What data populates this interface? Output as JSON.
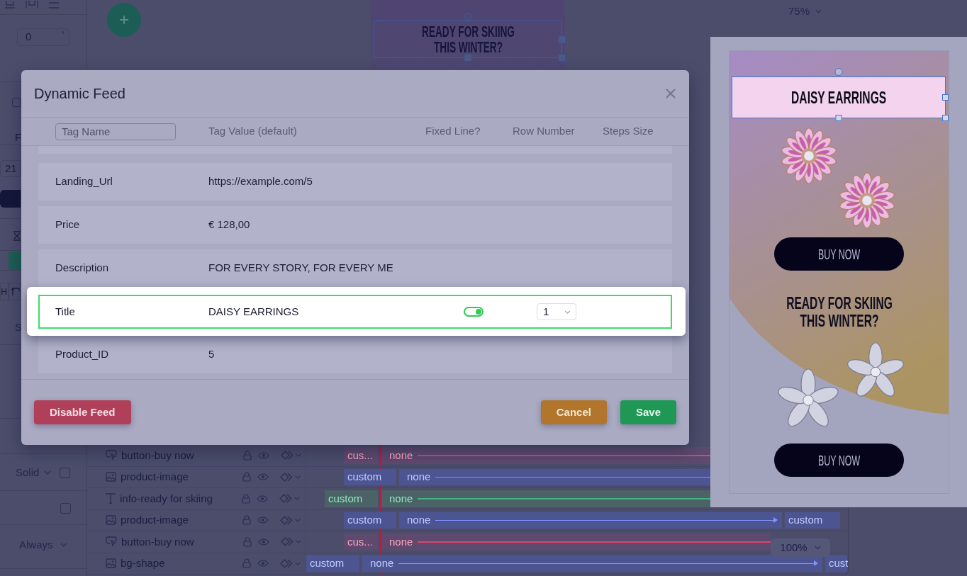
{
  "properties_panel": {
    "rotation": {
      "value": "0",
      "unit": "°"
    },
    "checkbox_1": {
      "checked": false
    },
    "label_1": "F",
    "field_1": "21",
    "label_2": "H",
    "label_3": "S",
    "border_style": "Solid",
    "checkbox_2": {
      "checked": false
    },
    "checkbox_3": {
      "checked": false
    },
    "visibility": "Always"
  },
  "canvas": {
    "headline": "READY FOR SKIING THIS WINTER?",
    "zoom": "75%"
  },
  "timeline": {
    "layers": [
      {
        "kind": "button",
        "name": "button-buy now",
        "segments": [
          {
            "label": "cus..."
          },
          {
            "label": "none"
          }
        ]
      },
      {
        "kind": "image",
        "name": "product-image",
        "segments": [
          {
            "label": "custom"
          },
          {
            "label": "none"
          }
        ]
      },
      {
        "kind": "text",
        "name": "info-ready for skiing",
        "segments": [
          {
            "label": "custom"
          },
          {
            "label": "none"
          }
        ]
      },
      {
        "kind": "image",
        "name": "product-image",
        "segments": [
          {
            "label": "custom"
          },
          {
            "label": "none"
          },
          {
            "label": "custom"
          }
        ]
      },
      {
        "kind": "button",
        "name": "button-buy now",
        "segments": [
          {
            "label": "cus..."
          },
          {
            "label": "none"
          }
        ]
      },
      {
        "kind": "image",
        "name": "bg-shape",
        "segments": [
          {
            "label": "custom"
          },
          {
            "label": "none"
          },
          {
            "label": "cust"
          }
        ]
      }
    ],
    "zoom": "100%"
  },
  "dialog": {
    "title": "Dynamic Feed",
    "filter": {
      "placeholder": "Tag Name"
    },
    "columns": [
      "Tag Value (default)",
      "Fixed Line?",
      "Row Number",
      "Steps Size"
    ],
    "rows": [
      {
        "tag": "Landing_Url",
        "value": "https://example.com/5",
        "highlighted": false
      },
      {
        "tag": "Price",
        "value": "€ 128,00",
        "highlighted": false
      },
      {
        "tag": "Description",
        "value": "FOR EVERY STORY, FOR EVERY ME",
        "highlighted": false
      },
      {
        "tag": "Title",
        "value": "DAISY EARRINGS",
        "highlighted": true,
        "fixed_line": {
          "on": true
        },
        "row_number": "1"
      },
      {
        "tag": "Product_ID",
        "value": "5",
        "highlighted": false
      }
    ],
    "buttons": [
      {
        "kind": "danger",
        "label": "Disable Feed"
      },
      {
        "kind": "warning",
        "label": "Cancel"
      },
      {
        "kind": "success",
        "label": "Save"
      }
    ]
  },
  "preview": {
    "title": "DAISY EARRINGS",
    "buttons": [
      "BUY NOW",
      "BUY NOW"
    ],
    "headline": "READY FOR SKIING THIS WINTER?"
  }
}
